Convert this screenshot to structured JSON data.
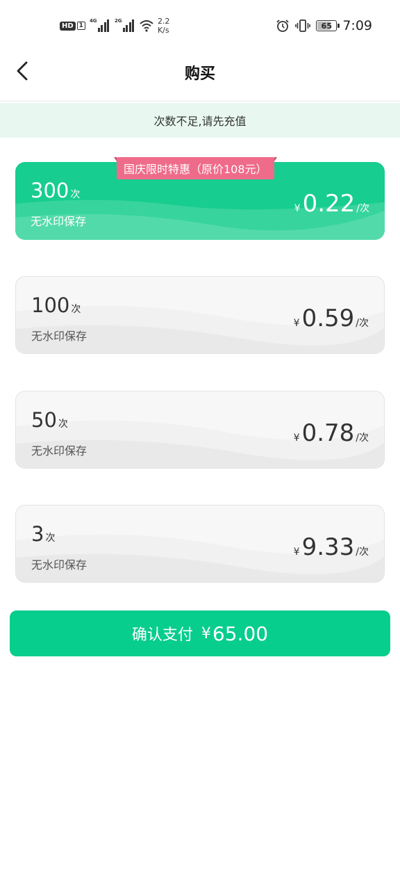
{
  "status_bar": {
    "hd_badge": "HD",
    "sim_index": "1",
    "signal1_label": "4G",
    "signal2_label": "2G",
    "speed_value": "2.2",
    "speed_unit": "K/s",
    "battery_level": "65",
    "battery_fraction": 0.65,
    "time": "7:09",
    "icons": [
      "hd-icon",
      "signal-4g-icon",
      "signal-2g-icon",
      "wifi-icon",
      "alarm-icon",
      "vibrate-icon",
      "battery-icon"
    ]
  },
  "header": {
    "title": "购买",
    "back_icon": "chevron-left-icon"
  },
  "notice": {
    "text": "次数不足,请先充值"
  },
  "promo": {
    "text": "国庆限时特惠（原价108元）"
  },
  "packages": [
    {
      "count": "300",
      "count_unit": "次",
      "desc": "无水印保存",
      "currency": "¥",
      "price": "0.22",
      "price_unit": "/次",
      "selected": true
    },
    {
      "count": "100",
      "count_unit": "次",
      "desc": "无水印保存",
      "currency": "¥",
      "price": "0.59",
      "price_unit": "/次",
      "selected": false
    },
    {
      "count": "50",
      "count_unit": "次",
      "desc": "无水印保存",
      "currency": "¥",
      "price": "0.78",
      "price_unit": "/次",
      "selected": false
    },
    {
      "count": "3",
      "count_unit": "次",
      "desc": "无水印保存",
      "currency": "¥",
      "price": "9.33",
      "price_unit": "/次",
      "selected": false
    }
  ],
  "pay_button": {
    "label": "确认支付",
    "currency": "¥",
    "amount": "65.00"
  },
  "colors": {
    "accent": "#07cd8d",
    "selected_card": "#17cd8f",
    "promo": "#ef6b8a",
    "notice_bg": "#e8f8f1"
  }
}
